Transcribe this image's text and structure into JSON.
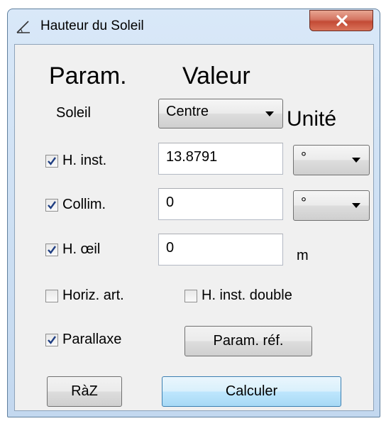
{
  "window": {
    "title": "Hauteur du Soleil",
    "close_symbol": "x"
  },
  "headers": {
    "param": "Param.",
    "valeur": "Valeur",
    "unite": "Unité"
  },
  "soleil": {
    "label": "Soleil",
    "selected": "Centre"
  },
  "h_inst": {
    "label": "H. inst.",
    "checked": true,
    "value": "13.8791",
    "unit": "°"
  },
  "collim": {
    "label": "Collim.",
    "checked": true,
    "value": "0",
    "unit": "°"
  },
  "h_oeil": {
    "label": "H. œil",
    "checked": true,
    "value": "0",
    "unit": "m"
  },
  "horiz_art": {
    "label": "Horiz. art.",
    "checked": false
  },
  "h_inst_double": {
    "label": "H. inst. double",
    "checked": false
  },
  "parallaxe": {
    "label": "Parallaxe",
    "checked": true
  },
  "buttons": {
    "param_ref": "Param. réf.",
    "raz": "RàZ",
    "calculer": "Calculer"
  },
  "icons": {
    "window": "angle-icon",
    "close": "close-icon",
    "dropdown": "chevron-down-icon",
    "checkmark": "checkmark-icon"
  },
  "colors": {
    "close_button": "#c75b47",
    "primary_button": "#bee6fd",
    "window_frame": "#c3d8ef",
    "checkmark": "#1f3e82"
  }
}
